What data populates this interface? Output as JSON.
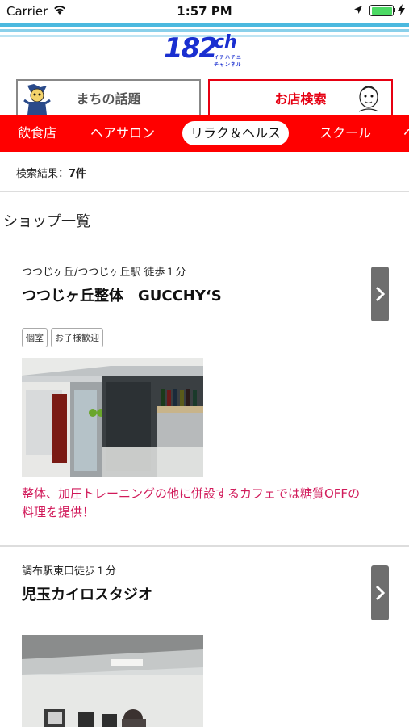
{
  "status_bar": {
    "carrier": "Carrier",
    "time": "1:57 PM"
  },
  "header": {
    "logo_main": "182",
    "logo_ch": "ch",
    "logo_sub": "イチハチニ チャンネル"
  },
  "tabs": [
    {
      "label": "まちの話題"
    },
    {
      "label": "お店検索"
    }
  ],
  "categories": [
    "飲食店",
    "ヘアサロン",
    "リラク＆ヘルス",
    "スクール",
    "ペ"
  ],
  "active_category": "リラク＆ヘルス",
  "results": {
    "label": "検索結果：",
    "count": "7件"
  },
  "list_title": "ショップ一覧",
  "shops": [
    {
      "access": "つつじヶ丘/つつじヶ丘駅 徒歩１分",
      "name": "つつじヶ丘整体　GUCCHY‘S",
      "tags": [
        "個室",
        "お子様歓迎"
      ],
      "description": "整体、加圧トレーニングの他に併設するカフェでは糖質OFFの料理を提供！"
    },
    {
      "access": "調布駅東口徒歩１分",
      "name": "児玉カイロスタジオ"
    }
  ],
  "colors": {
    "accent_red": "#ff0000",
    "logo_blue": "#1a2fd0",
    "desc_pink": "#d11a5a",
    "header_blue": "#4bb9df"
  },
  "icons": [
    "wifi-icon",
    "location-icon",
    "battery-icon",
    "charging-icon",
    "chevron-right-icon",
    "mascot-icon"
  ]
}
